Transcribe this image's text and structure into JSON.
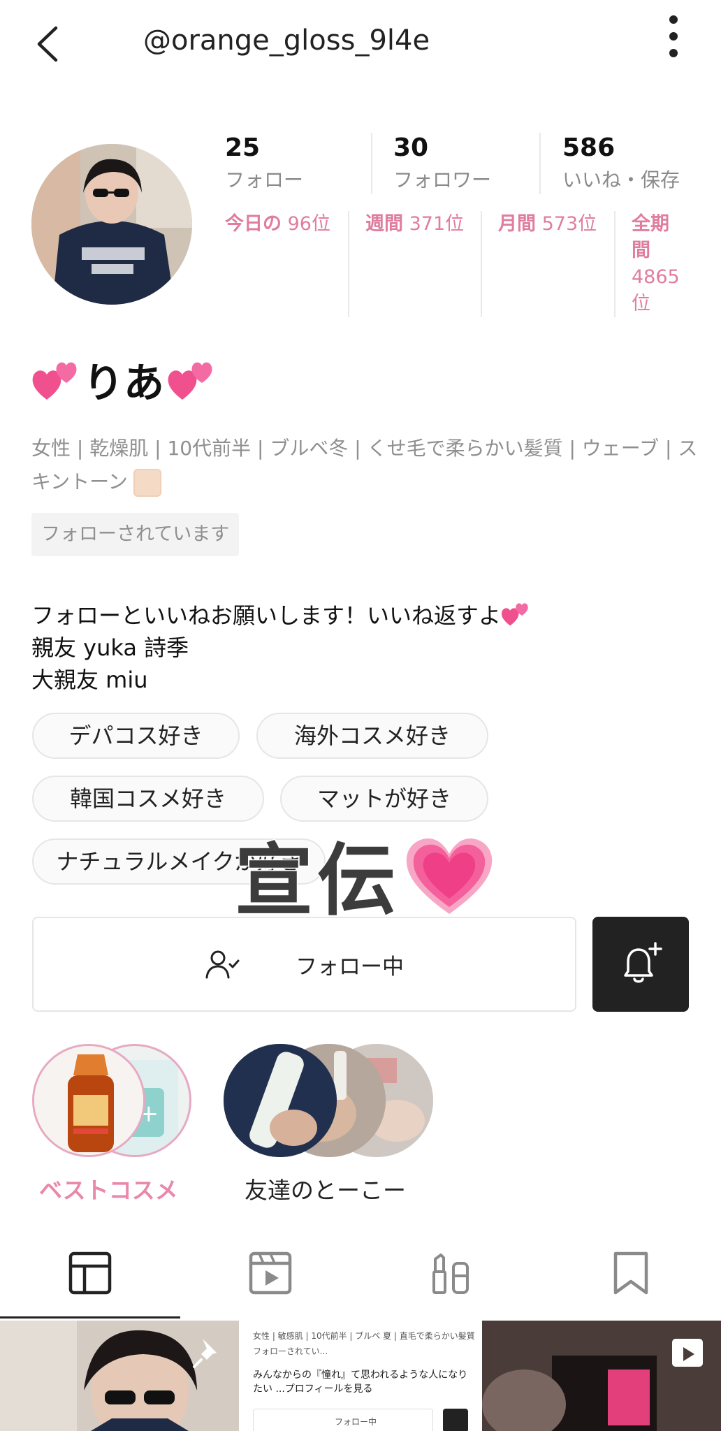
{
  "header": {
    "handle": "@orange_gloss_9l4e"
  },
  "stats": [
    {
      "value": "25",
      "label": "フォロー"
    },
    {
      "value": "30",
      "label": "フォロワー"
    },
    {
      "value": "586",
      "label": "いいね・保存"
    }
  ],
  "rankings": {
    "today_label": "今日の",
    "today_value": "96位",
    "week_label": "週間",
    "week_value": "371位",
    "month_label": "月間",
    "month_value": "573位",
    "all_label_1": "全期",
    "all_label_2": "間",
    "all_value_1": "4865",
    "all_value_2": "位"
  },
  "profile": {
    "display_name": "りあ",
    "attributes_line1": "女性 | 乾燥肌 | 10代前半 | ブルベ冬 | くせ毛で柔らかい髪質 | ウェーブ | ス",
    "attributes_line2": "キントーン",
    "followed_badge": "フォローされています",
    "bio_line1": "フォローといいねお願いします！いいね返すよ",
    "bio_line2": "親友  yuka  詩季",
    "bio_line3": "大親友  miu"
  },
  "tags": [
    "デパコス好き",
    "海外コスメ好き",
    "韓国コスメ好き",
    "マットが好き",
    "ナチュラルメイクが好き"
  ],
  "overlay": {
    "promo_text": "宣伝"
  },
  "actions": {
    "follow_label": "フォロー中"
  },
  "highlights": [
    {
      "label": "ベストコスメ",
      "color": "#e888aa"
    },
    {
      "label": "友達のとーこー",
      "color": "#222222"
    }
  ],
  "grid_preview": {
    "line1": "女性 | 敏感肌 | 10代前半 | ブルベ 夏 | 直毛で柔らかい髪質",
    "line2": "フォローされてい...",
    "line3": "みんなからの『憧れ』て思われるような人になり",
    "line4": "たい ...プロフィールを見る",
    "line5": "フォロー中"
  },
  "colors": {
    "accent_pink": "#e07d9f",
    "heart_pink": "#f0508e"
  }
}
